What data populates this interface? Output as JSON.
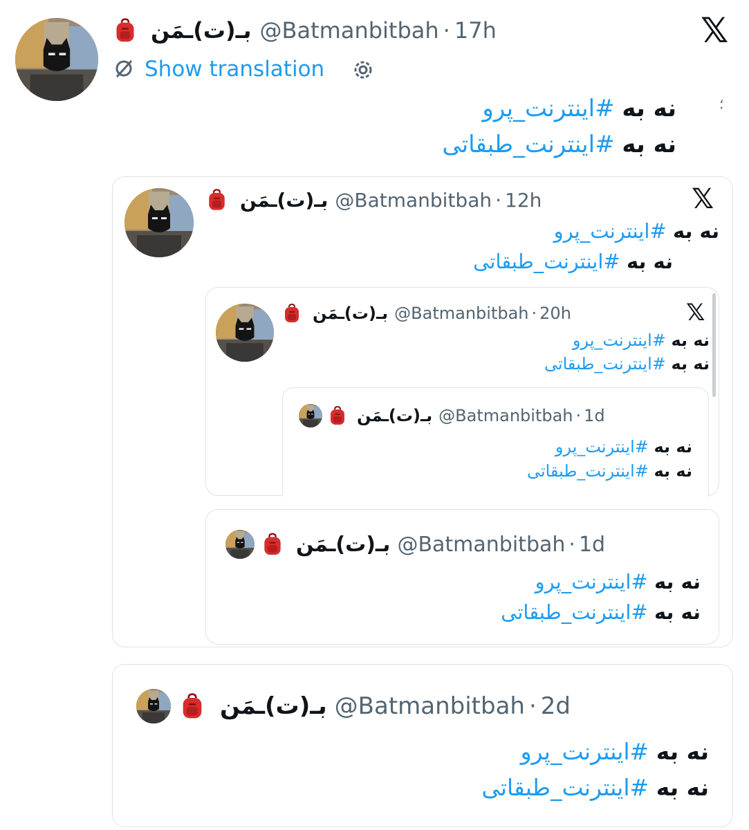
{
  "main": {
    "name": "بـ(ت)ـمَن",
    "handle": "@Batmanbitbah",
    "time": "17h",
    "show_translation": "Show translation",
    "line1_prefix": "نه به",
    "line1_tag": "#اینترنت_پرو",
    "line2_prefix": "نه به",
    "line2_tag": "#اینترنت_طبقاتی",
    "stray_mark": "؛"
  },
  "quote1": {
    "name": "بـ(ت)ـمَن",
    "handle": "@Batmanbitbah",
    "time": "12h",
    "line1_prefix": "نه به",
    "line1_tag": "#اینترنت_پرو",
    "line2_prefix": "نه به",
    "line2_tag": "#اینترنت_طبقاتی"
  },
  "quote2": {
    "name": "بـ(ت)ـمَن",
    "handle": "@Batmanbitbah",
    "time": "20h",
    "line1_prefix": "نه به",
    "line1_tag": "#اینترنت_پرو",
    "line2_prefix": "نه به",
    "line2_tag": "#اینترنت_طبقاتی"
  },
  "quote3": {
    "name": "بـ(ت)ـمَن",
    "handle": "@Batmanbitbah",
    "time": "1d",
    "line1_prefix": "نه به",
    "line1_tag": "#اینترنت_پرو",
    "line2_prefix": "نه به",
    "line2_tag": "#اینترنت_طبقاتی"
  },
  "quote4": {
    "name": "بـ(ت)ـمَن",
    "handle": "@Batmanbitbah",
    "time": "1d",
    "line1_prefix": "نه به",
    "line1_tag": "#اینترنت_پرو",
    "line2_prefix": "نه به",
    "line2_tag": "#اینترنت_طبقاتی"
  },
  "quote5": {
    "name": "بـ(ت)ـمَن",
    "handle": "@Batmanbitbah",
    "time": "2d",
    "line1_prefix": "نه به",
    "line1_tag": "#اینترنت_پرو",
    "line2_prefix": "نه به",
    "line2_tag": "#اینترنت_طبقاتی"
  },
  "separator": "·",
  "icons": {
    "x_logo": "x-logo-icon",
    "bag": "backpack-emoji-icon",
    "translate": "translate-off-icon",
    "settings": "gear-icon"
  },
  "colors": {
    "link": "#1d9bf0",
    "text": "#0f1419",
    "muted": "#536471",
    "border": "#dfe3e7"
  }
}
